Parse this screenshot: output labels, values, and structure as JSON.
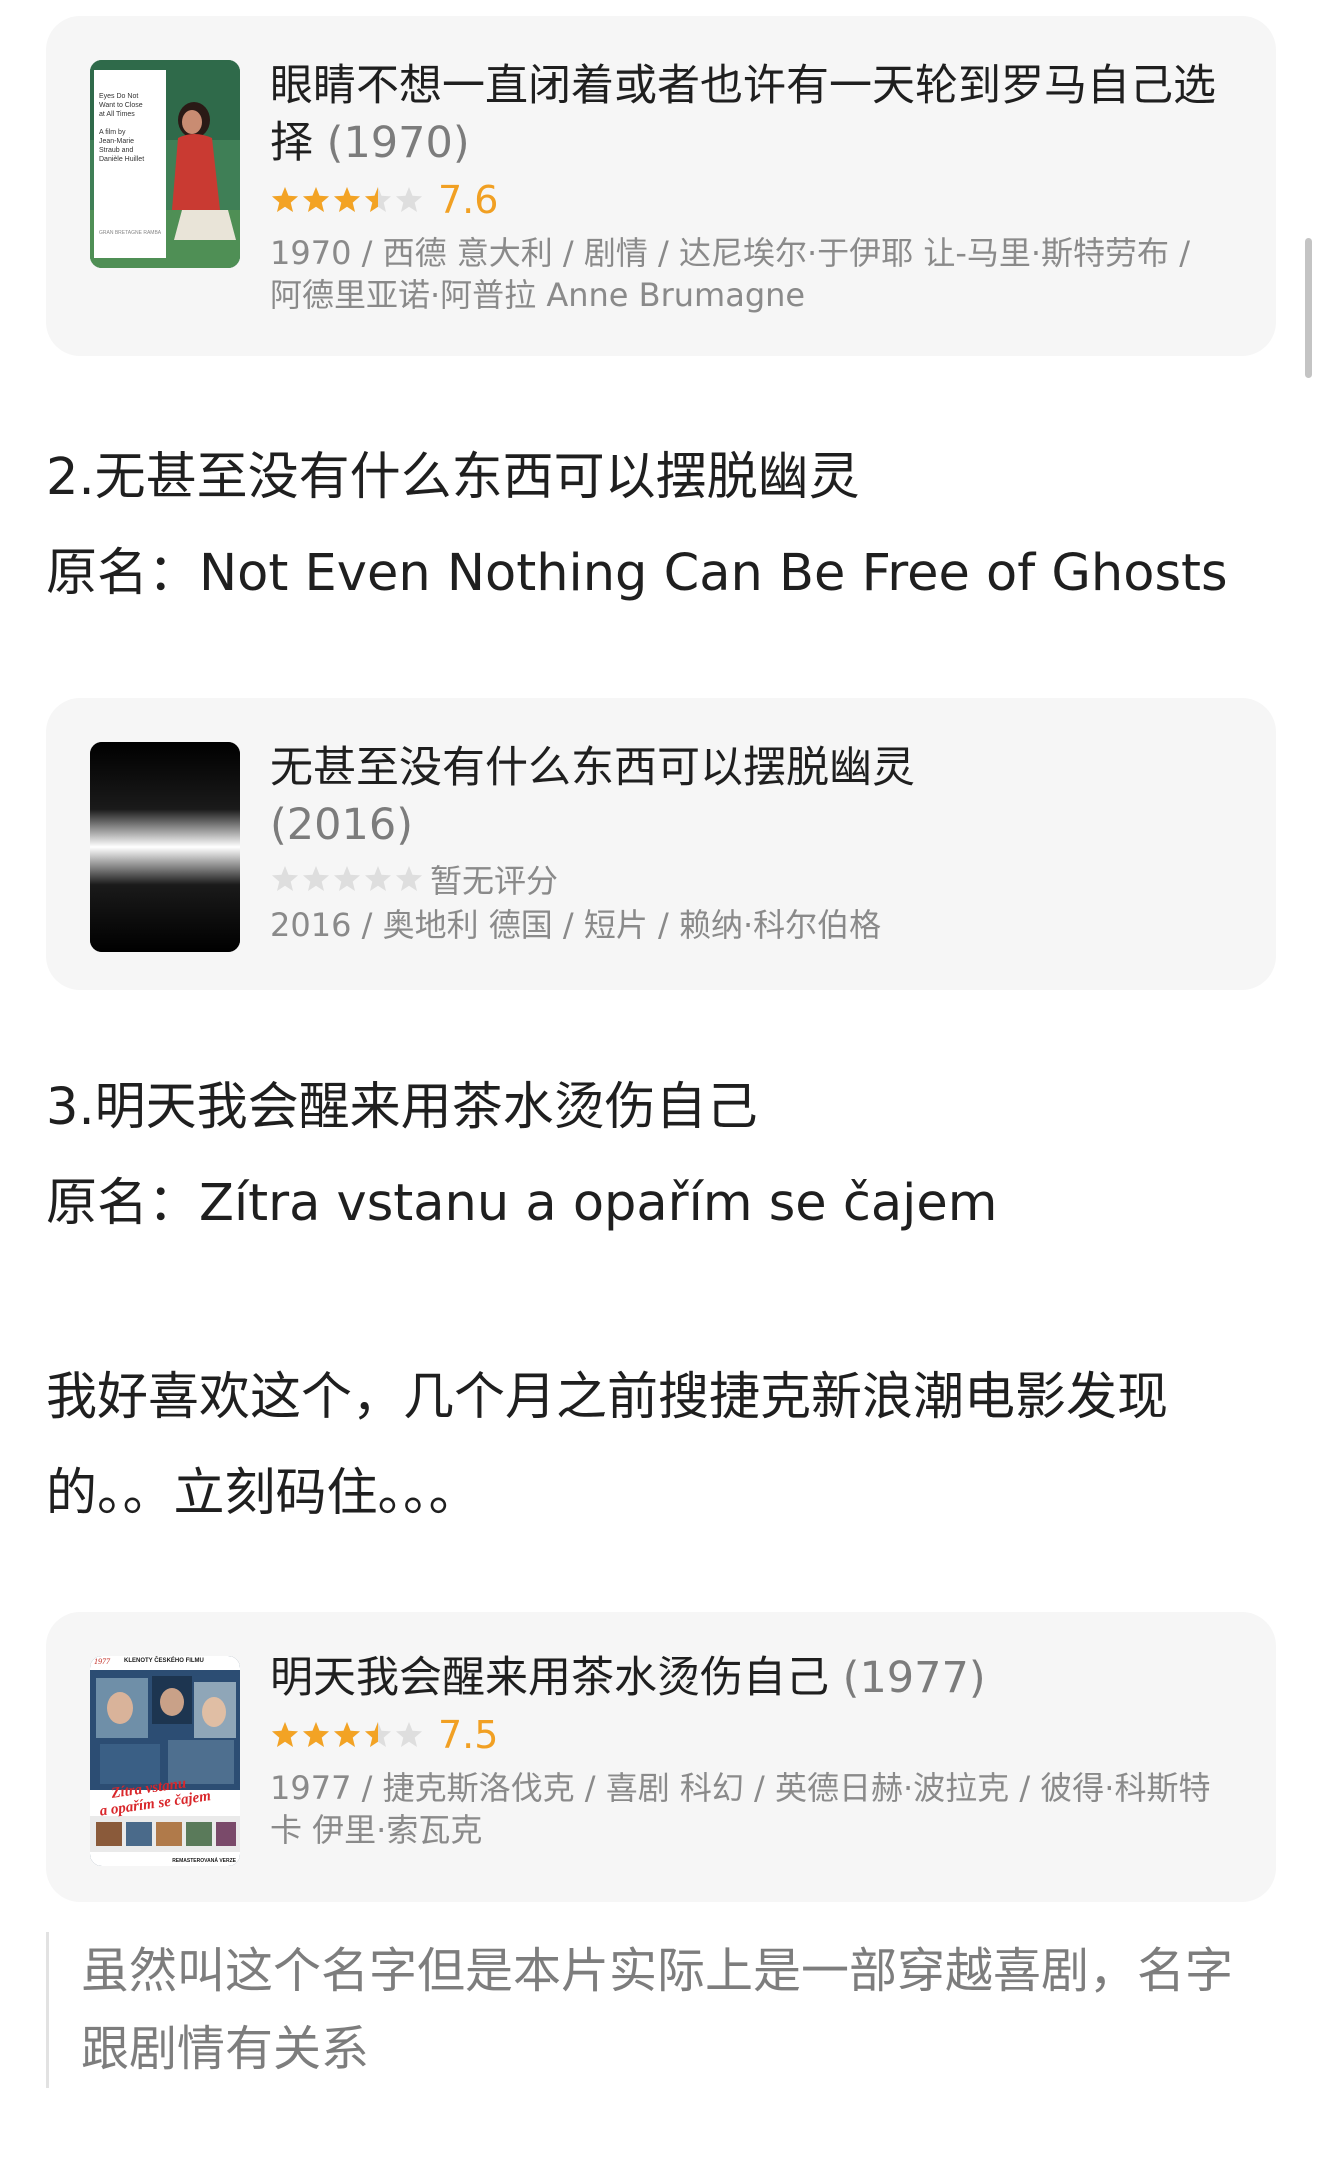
{
  "cards": [
    {
      "title": "眼睛不想一直闭着或者也许有一天轮到罗马自己选择",
      "year": "(1970)",
      "rating": 7.6,
      "rating_text": "7.6",
      "stars": 3.5,
      "meta": "1970 / 西德 意大利 / 剧情 / 达尼埃尔·于伊耶 让-马里·斯特劳布 / 阿德里亚诺·阿普拉 Anne Brumagne",
      "poster": {
        "lines": [
          "Eyes Do Not",
          "Want to Close",
          "at All Times",
          "",
          "A film by",
          "Jean-Marie",
          "Straub and",
          "Danièle Huillet"
        ],
        "footer": "GRAN BRETAGNE RAMBA"
      }
    },
    {
      "title": "无甚至没有什么东西可以摆脱幽灵",
      "year": "(2016)",
      "rating_text": "暂无评分",
      "stars": 0,
      "meta": "2016 / 奥地利 德国 / 短片 / 赖纳·科尔伯格"
    },
    {
      "title": "明天我会醒来用茶水烫伤自己",
      "year": "(1977)",
      "rating": 7.5,
      "rating_text": "7.5",
      "stars": 3.5,
      "meta": "1977 / 捷克斯洛伐克 / 喜剧 科幻 / 英德日赫·波拉克 / 彼得·科斯特卡 伊里·索瓦克",
      "poster": {
        "top_year": "1977",
        "top_banner": "KLENOTY ČESKÉHO FILMU",
        "script_line1": "Zítra vstanu",
        "script_line2": "a opařím se čajem",
        "footer": "REMASTEROVANÁ VERZE"
      }
    }
  ],
  "section2": {
    "heading": "2.无甚至没有什么东西可以摆脱幽灵",
    "original": "原名：Not Even Nothing Can Be Free of Ghosts"
  },
  "section3": {
    "heading": "3.明天我会醒来用茶水烫伤自己",
    "original": "原名：Zítra vstanu a opařím se čajem",
    "paragraph": "我好喜欢这个，几个月之前搜捷克新浪潮电影发现的。。立刻码住。。。",
    "quote": "虽然叫这个名字但是本片实际上是一部穿越喜剧，名字跟剧情有关系"
  },
  "colors": {
    "star_filled": "#f3a324",
    "star_empty": "#dedede",
    "card_bg": "#f6f6f6"
  }
}
